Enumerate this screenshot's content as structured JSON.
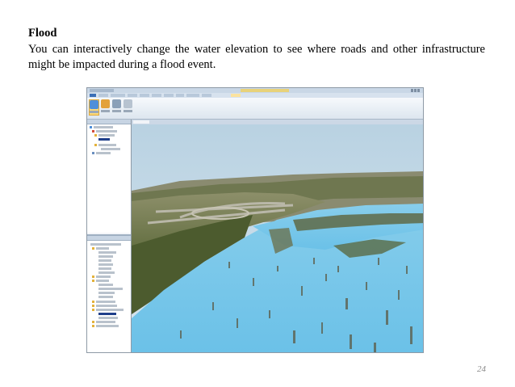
{
  "heading": "Flood",
  "body": "You can interactively change the water elevation to see where roads and other infrastructure might be impacted during a flood event.",
  "page_number": "24",
  "figure": {
    "description_kind": "screenshot of 3D GIS application showing flooded terrain",
    "colors": {
      "sky": "#c9dde9",
      "water": "#74c6ea",
      "land": "#6f7a46",
      "ribbon_active": "#fbd97a",
      "app_frame": "#dfe6ee"
    }
  }
}
